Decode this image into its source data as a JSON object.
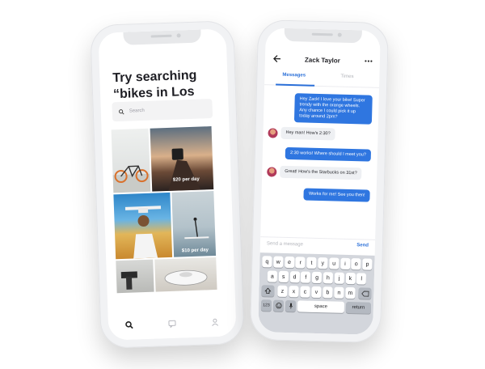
{
  "explore": {
    "headline_line1": "Try searching",
    "headline_line2": "“bikes in Los Angeles”",
    "search_placeholder": "Search",
    "listings": [
      {
        "price": "$20 per day"
      },
      {
        "price": "$10 per day"
      }
    ],
    "tabbar": {
      "icons": [
        "search-icon",
        "chat-icon",
        "profile-icon"
      ]
    }
  },
  "chat": {
    "contact_name": "Zack Taylor",
    "tabs": [
      {
        "label": "Messages",
        "active": true
      },
      {
        "label": "Times",
        "active": false
      }
    ],
    "messages": [
      {
        "from": "me",
        "text": "Hey Zack! I love your bike! Super trendy with the orange wheels. Any chance I could pick it up today around 2pm?"
      },
      {
        "from": "them",
        "text": "Hey man! How's 2:30?"
      },
      {
        "from": "me",
        "text": "2:30 works! Where should I meet you?"
      },
      {
        "from": "them",
        "text": "Great! How's the Starbucks on 31st?"
      },
      {
        "from": "me",
        "text": "Works for me! See you then!"
      }
    ],
    "composer": {
      "placeholder": "Send a message",
      "send_label": "Send"
    },
    "keyboard": {
      "row1": [
        "q",
        "w",
        "e",
        "r",
        "t",
        "y",
        "u",
        "i",
        "o",
        "p"
      ],
      "row2": [
        "a",
        "s",
        "d",
        "f",
        "g",
        "h",
        "j",
        "k",
        "l"
      ],
      "row3": [
        "z",
        "x",
        "c",
        "v",
        "b",
        "n",
        "m"
      ],
      "numbers_key": "123",
      "space_key": "space",
      "return_key": "return"
    }
  },
  "colors": {
    "accent": "#2f76e0",
    "text": "#1e1e24",
    "bubble_in": "#eef0f3",
    "keyboard_bg": "#d3d6dc"
  }
}
